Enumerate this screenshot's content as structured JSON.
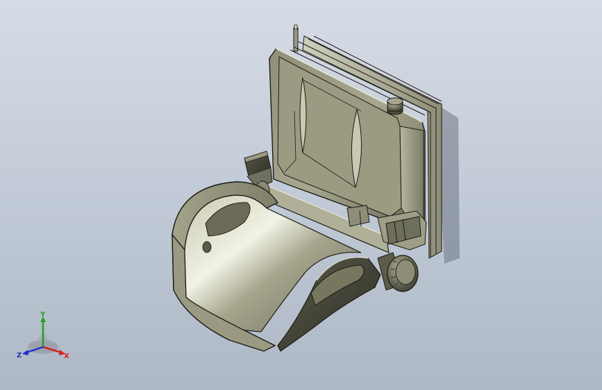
{
  "viewport": {
    "background_top": "#d6dce5",
    "background_bottom": "#aeb8c6"
  },
  "model": {
    "body_color": "#a8a890",
    "body_shadow_color": "#3e3e34",
    "edge_color": "#1a1a14"
  },
  "triad": {
    "x_label": "X",
    "y_label": "Y",
    "z_label": "Z",
    "x_color": "#d42020",
    "y_color": "#20a020",
    "z_color": "#2030c8"
  }
}
